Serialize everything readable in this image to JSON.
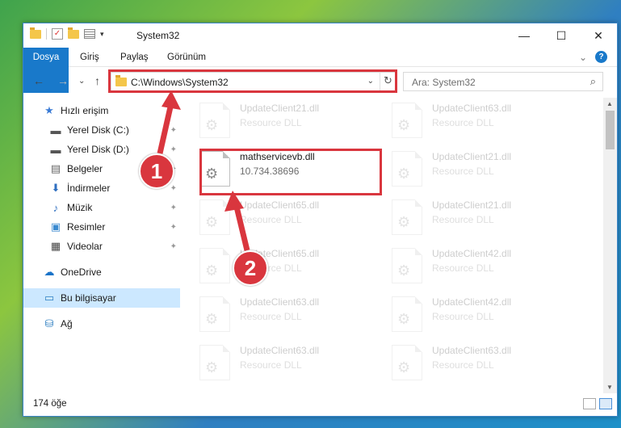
{
  "window": {
    "title": "System32",
    "controls": {
      "minimize": "—",
      "maximize": "☐",
      "close": "✕"
    }
  },
  "ribbon": {
    "tabs": [
      "Dosya",
      "Giriş",
      "Paylaş",
      "Görünüm"
    ],
    "collapse": "⌄",
    "help": "?"
  },
  "nav": {
    "back": "←",
    "forward": "→",
    "recent": "⌄",
    "up": "↑",
    "address": "C:\\Windows\\System32",
    "address_dropdown": "⌄",
    "refresh": "↻",
    "search_placeholder": "Ara: System32",
    "search_icon": "⌕"
  },
  "sidebar": {
    "items": [
      {
        "label": "Hızlı erişim",
        "icon": "star-icon",
        "glyph": "★",
        "pinned": false
      },
      {
        "label": "Yerel Disk (C:)",
        "icon": "drive-icon",
        "glyph": "▬",
        "pinned": true
      },
      {
        "label": "Yerel Disk (D:)",
        "icon": "drive-icon",
        "glyph": "▬",
        "pinned": true
      },
      {
        "label": "Belgeler",
        "icon": "documents-icon",
        "glyph": "▤",
        "pinned": true
      },
      {
        "label": "İndirmeler",
        "icon": "download-icon",
        "glyph": "⬇",
        "pinned": true
      },
      {
        "label": "Müzik",
        "icon": "music-icon",
        "glyph": "♪",
        "pinned": true
      },
      {
        "label": "Resimler",
        "icon": "pictures-icon",
        "glyph": "▣",
        "pinned": true
      },
      {
        "label": "Videolar",
        "icon": "video-icon",
        "glyph": "▦",
        "pinned": true
      },
      {
        "label": "OneDrive",
        "icon": "cloud-icon",
        "glyph": "☁",
        "pinned": false
      },
      {
        "label": "Bu bilgisayar",
        "icon": "computer-icon",
        "glyph": "▭",
        "pinned": false,
        "selected": true
      },
      {
        "label": "Ağ",
        "icon": "network-icon",
        "glyph": "⛁",
        "pinned": false
      }
    ],
    "pin_glyph": "📌"
  },
  "files": [
    {
      "name": "UpdateClient21.dll",
      "sub": "Resource DLL",
      "faded": true
    },
    {
      "name": "UpdateClient63.dll",
      "sub": "Resource DLL",
      "faded": true
    },
    {
      "name": "mathservicevb.dll",
      "sub": "10.734.38696",
      "faded": false
    },
    {
      "name": "UpdateClient21.dll",
      "sub": "Resource DLL",
      "faded": true
    },
    {
      "name": "UpdateClient65.dll",
      "sub": "Resource DLL",
      "faded": true
    },
    {
      "name": "UpdateClient21.dll",
      "sub": "Resource DLL",
      "faded": true
    },
    {
      "name": "UpdateClient65.dll",
      "sub": "Resource DLL",
      "faded": true
    },
    {
      "name": "UpdateClient42.dll",
      "sub": "Resource DLL",
      "faded": true
    },
    {
      "name": "UpdateClient63.dll",
      "sub": "Resource DLL",
      "faded": true
    },
    {
      "name": "UpdateClient42.dll",
      "sub": "Resource DLL",
      "faded": true
    },
    {
      "name": "UpdateClient63.dll",
      "sub": "Resource DLL",
      "faded": true
    },
    {
      "name": "UpdateClient63.dll",
      "sub": "Resource DLL",
      "faded": true
    }
  ],
  "status": {
    "count": "174 öğe"
  },
  "callouts": [
    "1",
    "2"
  ],
  "colors": {
    "accent": "#1979ca",
    "highlight": "#d9363e",
    "selection": "#cce8ff"
  }
}
